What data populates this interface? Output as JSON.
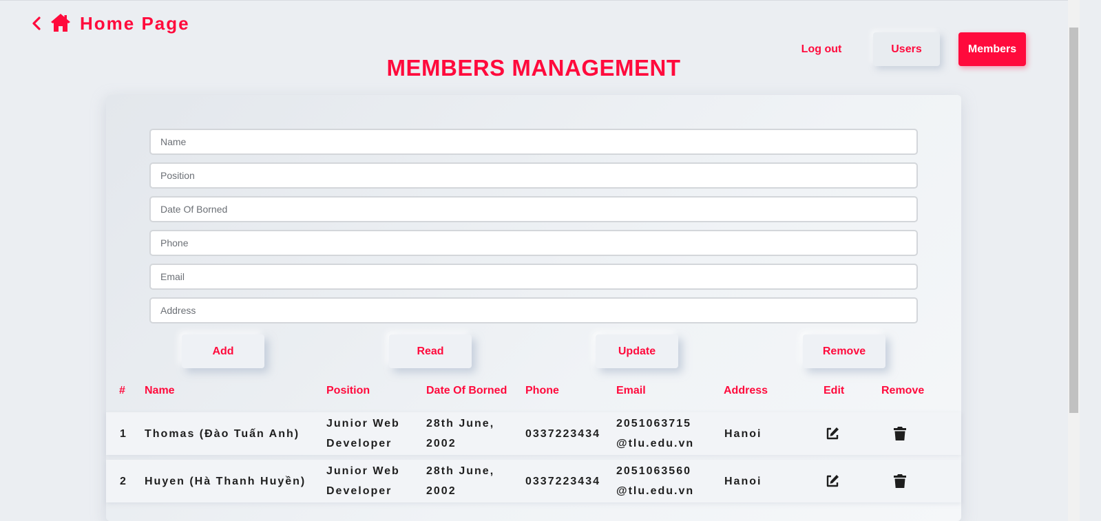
{
  "header": {
    "home_label": "Home Page"
  },
  "nav": {
    "logout": "Log out",
    "users": "Users",
    "members": "Members"
  },
  "page_title": "MEMBERS MANAGEMENT",
  "form": {
    "name_placeholder": "Name",
    "position_placeholder": "Position",
    "dob_placeholder": "Date Of Borned",
    "phone_placeholder": "Phone",
    "email_placeholder": "Email",
    "address_placeholder": "Address"
  },
  "actions": {
    "add": "Add",
    "read": "Read",
    "update": "Update",
    "remove": "Remove"
  },
  "table": {
    "headers": {
      "num": "#",
      "name": "Name",
      "position": "Position",
      "dob": "Date Of Borned",
      "phone": "Phone",
      "email": "Email",
      "address": "Address",
      "edit": "Edit",
      "remove": "Remove"
    },
    "rows": [
      {
        "num": "1",
        "name": "Thomas (Đào Tuấn Anh)",
        "position": "Junior Web\nDeveloper",
        "dob": "28th June,\n2002",
        "phone": "0337223434",
        "email": "2051063715\n@tlu.edu.vn",
        "address": "Hanoi"
      },
      {
        "num": "2",
        "name": "Huyen (Hà Thanh Huyền)",
        "position": "Junior Web\nDeveloper",
        "dob": "28th June,\n2002",
        "phone": "0337223434",
        "email": "2051063560\n@tlu.edu.vn",
        "address": "Hanoi"
      }
    ]
  },
  "colors": {
    "accent": "#ff0a3c",
    "background": "#ebeef2",
    "text": "#1e1e1e"
  }
}
